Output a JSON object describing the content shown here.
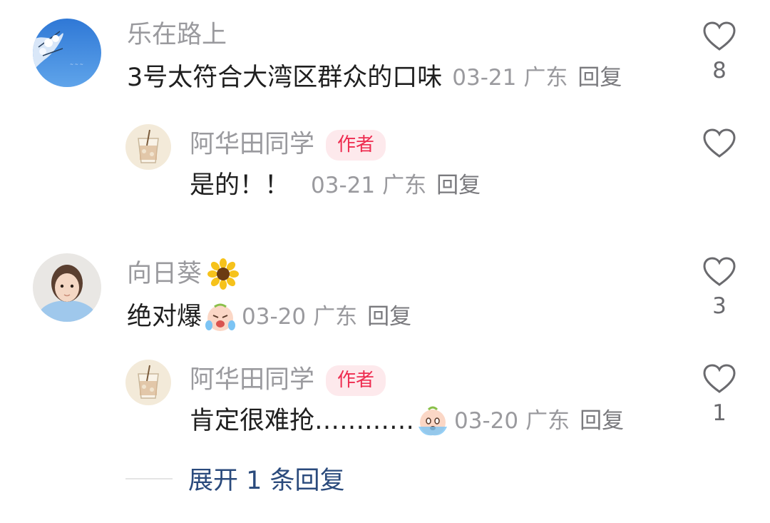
{
  "comments": [
    {
      "username": "乐在路上",
      "text": "3号太符合大湾区群众的口味",
      "date": "03-21",
      "location": "广东",
      "reply_label": "回复",
      "likes": "8",
      "avatar": "sky-flowers-avatar",
      "replies": [
        {
          "username": "阿华田同学",
          "badge": "作者",
          "text": "是的！！",
          "date": "03-21",
          "location": "广东",
          "reply_label": "回复",
          "likes": "",
          "avatar": "drink-cup-avatar"
        }
      ]
    },
    {
      "username": "向日葵",
      "username_emoji": "sunflower-emoji",
      "text": "绝对爆",
      "text_emoji": "crying-face-emoji",
      "date": "03-20",
      "location": "广东",
      "reply_label": "回复",
      "likes": "3",
      "avatar": "child-portrait-avatar",
      "replies": [
        {
          "username": "阿华田同学",
          "badge": "作者",
          "text": "肯定很难抢…………",
          "text_emoji": "scared-face-emoji",
          "date": "03-20",
          "location": "广东",
          "reply_label": "回复",
          "likes": "1",
          "avatar": "drink-cup-avatar"
        }
      ]
    }
  ],
  "expand_replies": "展开 1 条回复",
  "colors": {
    "badge_bg": "#fde9ec",
    "badge_text": "#ee2c50",
    "expand_text": "#2a4a7c"
  }
}
